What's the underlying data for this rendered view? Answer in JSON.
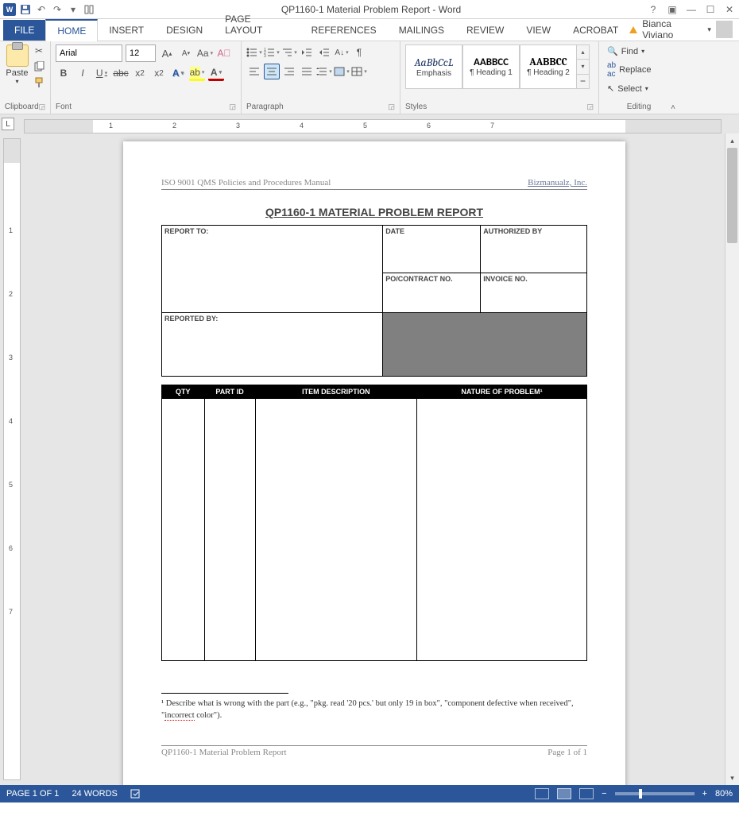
{
  "titlebar": {
    "title": "QP1160-1 Material Problem Report - Word"
  },
  "tabs": {
    "file": "FILE",
    "home": "HOME",
    "insert": "INSERT",
    "design": "DESIGN",
    "pagelayout": "PAGE LAYOUT",
    "references": "REFERENCES",
    "mailings": "MAILINGS",
    "review": "REVIEW",
    "view": "VIEW",
    "acrobat": "ACROBAT",
    "user": "Bianca Viviano"
  },
  "ribbon": {
    "clipboard": {
      "paste": "Paste",
      "label": "Clipboard"
    },
    "font": {
      "name": "Arial",
      "size": "12",
      "label": "Font"
    },
    "paragraph": {
      "label": "Paragraph"
    },
    "styles": {
      "label": "Styles",
      "s1_sample": "AaBbCcL",
      "s1_name": "Emphasis",
      "s2_sample": "AABBCC",
      "s2_name": "¶ Heading 1",
      "s3_sample": "AABBCC",
      "s3_name": "¶ Heading 2"
    },
    "editing": {
      "label": "Editing",
      "find": "Find",
      "replace": "Replace",
      "select": "Select"
    }
  },
  "ruler": {
    "n1": "1",
    "n2": "2",
    "n3": "3",
    "n4": "4",
    "n5": "5",
    "n6": "6",
    "n7": "7"
  },
  "doc": {
    "header_left": "ISO 9001 QMS Policies and Procedures Manual",
    "header_right": "Bizmanualz, Inc.",
    "title": "QP1160-1 MATERIAL PROBLEM REPORT",
    "report_to": "REPORT TO:",
    "date": "DATE",
    "authorized": "AUTHORIZED BY",
    "po": "PO/CONTRACT NO.",
    "invoice": "INVOICE NO.",
    "reported_by": "REPORTED BY:",
    "col_qty": "QTY",
    "col_partid": "PART ID",
    "col_desc": "ITEM DESCRIPTION",
    "col_nature": "NATURE OF PROBLEM¹",
    "fn_pre": "¹ Describe what is wrong with the part (e.g., \"pkg. read '20 pcs.' but only 19 in box\", \"component defective when received\", \"",
    "fn_word": "incorrect",
    "fn_post": " color\").",
    "footer_left": "QP1160-1 Material Problem Report",
    "footer_right": "Page 1 of 1"
  },
  "status": {
    "page": "PAGE 1 OF 1",
    "words": "24 WORDS",
    "zoom": "80%"
  }
}
